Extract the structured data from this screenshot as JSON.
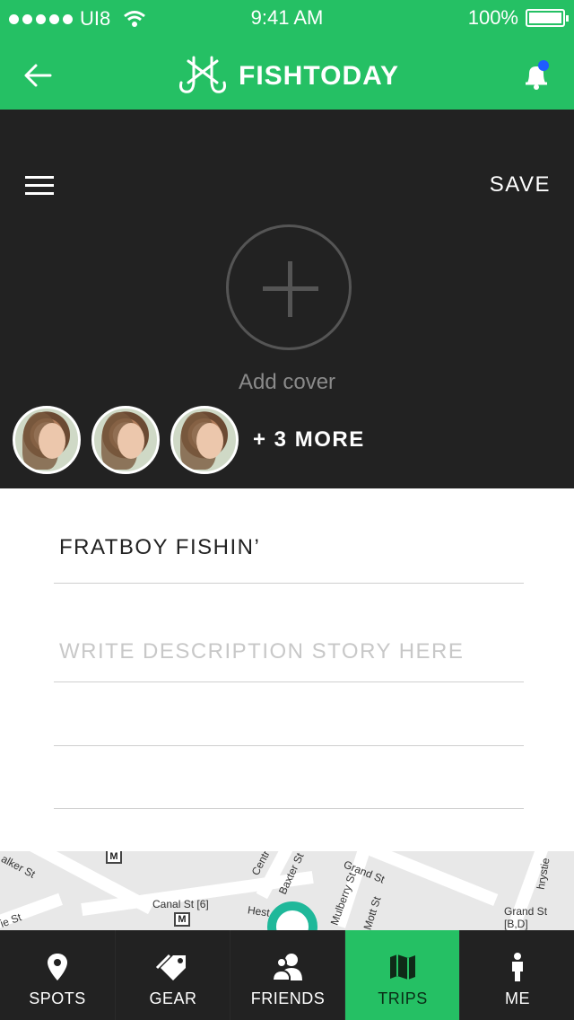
{
  "status_bar": {
    "carrier": "UI8",
    "time": "9:41 AM",
    "battery": "100%"
  },
  "header": {
    "app_name": "FISHTODAY",
    "icons": [
      "back-arrow-icon",
      "fishhook-logo-icon",
      "bell-icon"
    ],
    "notification_dot_color": "#1f5cff"
  },
  "cover": {
    "save_label": "SAVE",
    "add_cover_label": "Add cover",
    "more_participants": "+ 3 MORE"
  },
  "form": {
    "trip_title": "FRATBOY FISHIN’",
    "description_placeholder": "WRITE DESCRIPTION STORY HERE"
  },
  "map": {
    "labels": [
      "alker St",
      "Centr",
      "Baxter St",
      "Grand St",
      "hrystie",
      "Canal St [6]",
      "Hest",
      "Mulberry St",
      "Mott St",
      "Grand St [B,D]",
      "ie St"
    ]
  },
  "tabbar": {
    "tabs": [
      {
        "label": "SPOTS",
        "icon": "location-pin-icon",
        "active": false
      },
      {
        "label": "GEAR",
        "icon": "tag-icon",
        "active": false
      },
      {
        "label": "FRIENDS",
        "icon": "friends-icon",
        "active": false
      },
      {
        "label": "TRIPS",
        "icon": "map-icon",
        "active": true
      },
      {
        "label": "ME",
        "icon": "person-icon",
        "active": false
      }
    ]
  },
  "colors": {
    "brand_green": "#25c064",
    "dark_bg": "#222222",
    "map_pin": "#1fb89a"
  }
}
